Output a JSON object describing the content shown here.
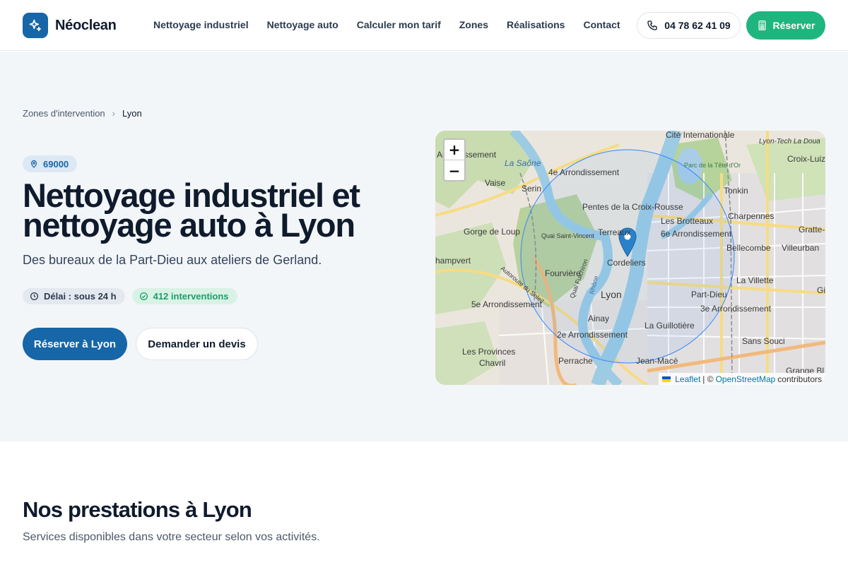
{
  "brand": {
    "name": "Néoclean"
  },
  "nav": [
    {
      "label": "Nettoyage industriel"
    },
    {
      "label": "Nettoyage auto"
    },
    {
      "label": "Calculer mon tarif"
    },
    {
      "label": "Zones"
    },
    {
      "label": "Réalisations"
    },
    {
      "label": "Contact"
    }
  ],
  "header": {
    "phone": "04 78 62 41 09",
    "book_label": "Réserver"
  },
  "breadcrumb": {
    "items": [
      "Zones d'intervention",
      "Lyon"
    ]
  },
  "hero": {
    "zip": "69000",
    "title": "Nettoyage industriel et nettoyage auto à Lyon",
    "subtitle": "Des bureaux de la Part-Dieu aux ateliers de Gerland.",
    "delay": "Délai : sous 24 h",
    "interventions": "412 interventions",
    "primary_cta": "Réserver à Lyon",
    "secondary_cta": "Demander un devis"
  },
  "map": {
    "zoom_in": "+",
    "zoom_out": "−",
    "attribution": {
      "leaflet": "Leaflet",
      "sep": "| ©",
      "osm": "OpenStreetMap",
      "suffix": "contributors"
    },
    "labels": [
      "Cité Internationale",
      "Lyon-Tech La Doua",
      "Croix-Luiz",
      "Arrondissement",
      "La Saône",
      "4e Arrondissement",
      "Parc de la Tête d'Or",
      "Vaise",
      "Serin",
      "Tonkin",
      "Pentes de la Croix-Rousse",
      "Charpennes",
      "Gorge de Loup",
      "Les Brotteaux",
      "Gratte-",
      "Quai Saint-Vincent",
      "Terreaux",
      "6e Arrondissement",
      "Bellecombe",
      "Villeurban",
      "hampvert",
      "Cordeliers",
      "Fourvière",
      "La Villette",
      "Lyon",
      "Part-Dieu",
      "Autoroute du Soleil",
      "5e Arrondissement",
      "Ainay",
      "3e Arrondissement",
      "La Guillotière",
      "2e Arrondissement",
      "Sans Souci",
      "Les Provinces",
      "Chavril",
      "Perrache",
      "Jean-Macé",
      "Grange Bl",
      "Gi",
      "Quai Fulchiron",
      "Rhône"
    ]
  },
  "services": {
    "title": "Nos prestations à Lyon",
    "subtitle": "Services disponibles dans votre secteur selon vos activités."
  }
}
